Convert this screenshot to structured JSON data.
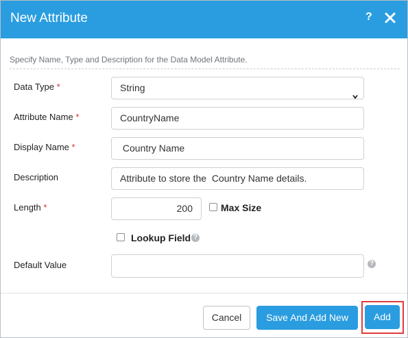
{
  "dialog": {
    "title": "New Attribute",
    "help_symbol": "?",
    "close_icon": "close-icon",
    "intro": "Specify Name, Type and Description for the Data Model Attribute."
  },
  "form": {
    "required_marker": "*",
    "data_type": {
      "label": "Data Type",
      "value": "String"
    },
    "attribute_name": {
      "label": "Attribute Name",
      "value": "CountryName"
    },
    "display_name": {
      "label": "Display Name",
      "value": " Country Name"
    },
    "description": {
      "label": "Description",
      "value": "Attribute to store the  Country Name details."
    },
    "length": {
      "label": "Length",
      "value": "200",
      "max_size_label": "Max Size",
      "max_size_checked": false
    },
    "lookup": {
      "label": "Lookup Field",
      "checked": false,
      "help_symbol": "?"
    },
    "default_value": {
      "label": "Default Value",
      "value": "",
      "help_symbol": "?"
    }
  },
  "buttons": {
    "cancel": "Cancel",
    "save_and_add_new": "Save And Add New",
    "add": "Add"
  },
  "colors": {
    "header": "#2a9de0",
    "primary": "#2a9de0",
    "required": "#d62e2e",
    "highlight": "#e23b3b"
  }
}
